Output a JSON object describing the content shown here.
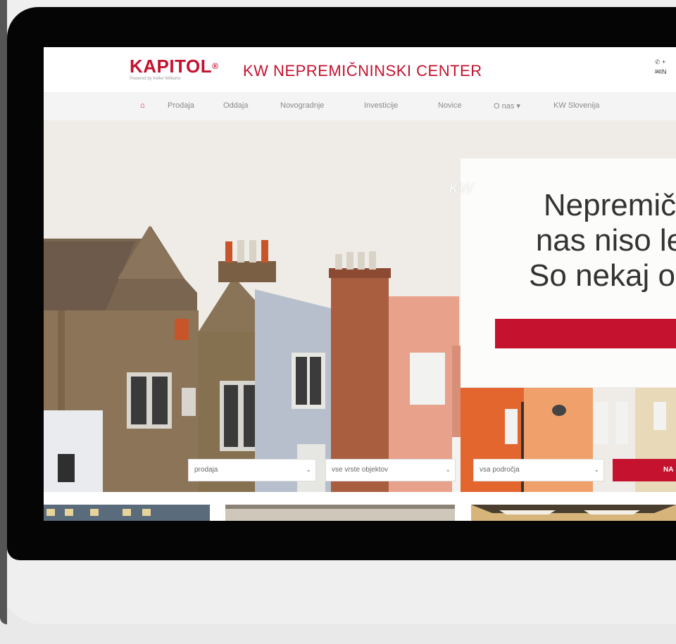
{
  "header": {
    "logo": "KAPITOL",
    "logo_reg": "®",
    "logo_sub": "Powered by Keller Williams",
    "site_title": "KW NEPREMIČNINSKI CENTER",
    "phone": "+",
    "email": "IN"
  },
  "nav": {
    "items": [
      {
        "label": "Prodaja"
      },
      {
        "label": "Oddaja"
      },
      {
        "label": "Novogradnje"
      },
      {
        "label": "Investicije"
      },
      {
        "label": "Novice"
      },
      {
        "label": "O nas ▾"
      },
      {
        "label": "KW Slovenija"
      }
    ]
  },
  "hero": {
    "kw": "KW",
    "lines": [
      "Nepremič",
      "nas niso le",
      "So nekaj os"
    ]
  },
  "search": {
    "type_value": "prodaja",
    "object_value": "vse vrste objektov",
    "area_value": "vsa področja",
    "button_label": "NA"
  },
  "colors": {
    "brand": "#c4122f",
    "nav_bg": "#f4f4f4"
  },
  "icons": {
    "home": "home-icon",
    "phone": "phone-icon",
    "mail": "mail-icon",
    "chevron": "chevron-down-icon"
  }
}
